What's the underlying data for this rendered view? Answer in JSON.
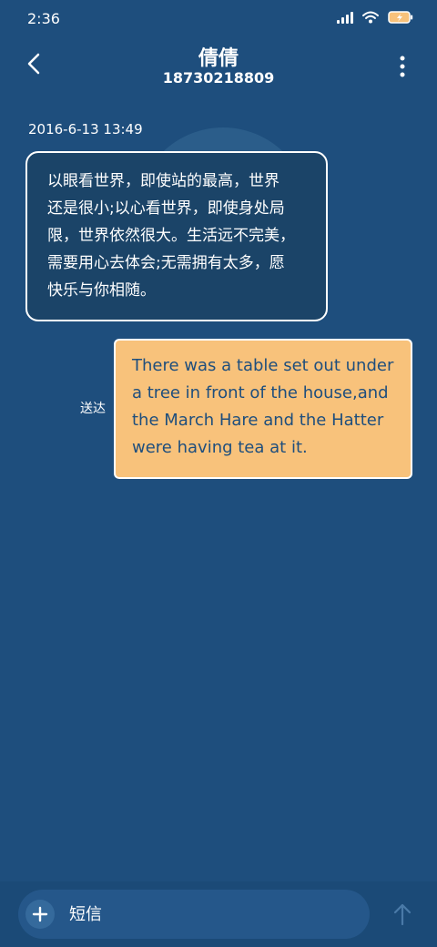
{
  "status_bar": {
    "time": "2:36",
    "icons": [
      "signal-icon",
      "wifi-icon",
      "battery-icon"
    ]
  },
  "header": {
    "contact_name": "倩倩",
    "contact_number": "18730218809",
    "back_icon": "chevron-left-icon",
    "more_icon": "more-vertical-icon"
  },
  "conversation": {
    "timestamp": "2016-6-13 13:49",
    "received_message": {
      "lines": [
        "以眼看世界，即使站的最高，世界",
        "还是很小;以心看世界，即使身处局",
        "限，世界依然很大。生活远不完美，",
        "需要用心去体会;无需拥有太多，愿",
        "快乐与你相随。"
      ]
    },
    "sent_message": {
      "lines": [
        "There was a table set out under",
        "a tree in front of the house,and",
        "the March Hare and the Hatter",
        "were having tea at it."
      ],
      "status": "送达"
    }
  },
  "composer": {
    "placeholder": "短信",
    "add_icon": "plus-icon",
    "send_icon": "arrow-up-icon"
  },
  "colors": {
    "background": "#1e4e7d",
    "received_bubble": "#1b4468",
    "sent_bubble": "#f8c27b",
    "sent_text": "#1e4e7d",
    "battery": "#f8c27b"
  }
}
